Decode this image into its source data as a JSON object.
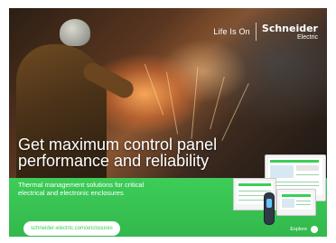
{
  "brand": {
    "tagline": "Life Is On",
    "company": "Schneider",
    "company_sub": "Electric"
  },
  "hero": {
    "headline_line1": "Get maximum control panel",
    "headline_line2": "performance and reliability"
  },
  "subheadline": {
    "line1": "Thermal management solutions for critical",
    "line2": "electrical and electronic enclosures"
  },
  "cta": {
    "url_label": "schneider-electric.com/enclosures"
  },
  "explore": {
    "label": "Explore"
  },
  "colors": {
    "brand_green": "#3dcd58",
    "white": "#ffffff"
  },
  "icons": {
    "explore": "circle-icon"
  }
}
